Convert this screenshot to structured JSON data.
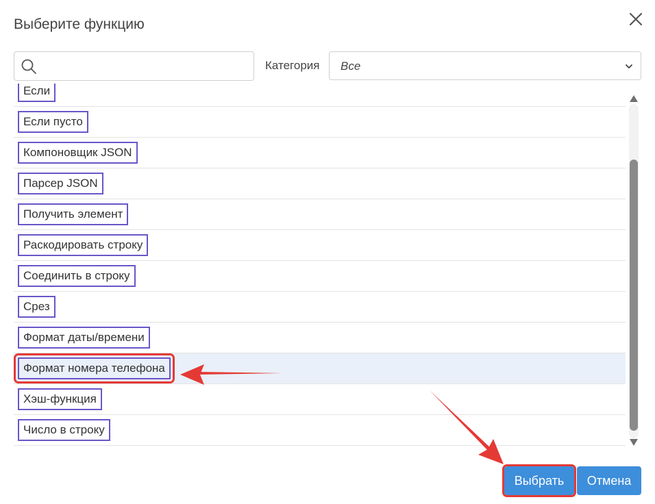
{
  "dialog": {
    "title": "Выберите функцию"
  },
  "search": {
    "value": "",
    "placeholder": ""
  },
  "category": {
    "label": "Категория",
    "selected": "Все"
  },
  "functions": [
    {
      "label": "Если",
      "selected": false
    },
    {
      "label": "Если пусто",
      "selected": false
    },
    {
      "label": "Компоновщик JSON",
      "selected": false
    },
    {
      "label": "Парсер JSON",
      "selected": false
    },
    {
      "label": "Получить элемент",
      "selected": false
    },
    {
      "label": "Раскодировать строку",
      "selected": false
    },
    {
      "label": "Соединить в строку",
      "selected": false
    },
    {
      "label": "Срез",
      "selected": false
    },
    {
      "label": "Формат даты/времени",
      "selected": false
    },
    {
      "label": "Формат номера телефона",
      "selected": true
    },
    {
      "label": "Хэш-функция",
      "selected": false
    },
    {
      "label": "Число в строку",
      "selected": false
    }
  ],
  "buttons": {
    "select_label": "Выбрать",
    "cancel_label": "Отмена"
  },
  "icons": {
    "close": "close-icon",
    "search": "search-icon",
    "dropdown": "chevron-down-icon",
    "scroll_up": "triangle-up-icon",
    "scroll_down": "triangle-down-icon"
  },
  "colors": {
    "accent": "#3d8edb",
    "selected_row": "#e9f0f9",
    "highlight": "#e53935",
    "label_box": "#6a55c8"
  }
}
